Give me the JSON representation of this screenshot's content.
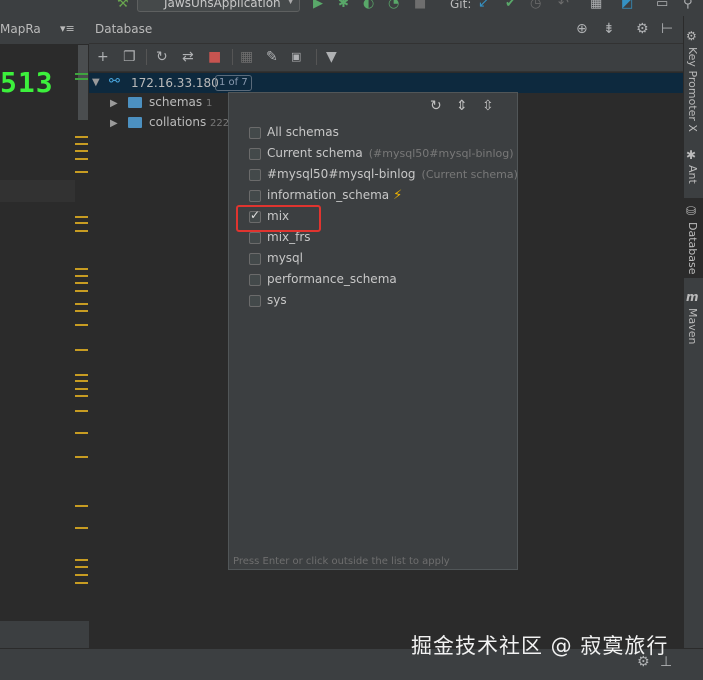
{
  "toolbar": {
    "run_config": "JawsUnsApplication",
    "git_label": "Git:"
  },
  "editor": {
    "tab_label": "MapRa",
    "tab_menu": "▾≡",
    "number_text": "513"
  },
  "database": {
    "title": "Database",
    "root": {
      "label": "172.16.33.180",
      "badge": "1 of 7"
    },
    "children": [
      {
        "label": "schemas",
        "count": "1"
      },
      {
        "label": "collations",
        "count": "222"
      }
    ]
  },
  "schema_popup": {
    "options": [
      {
        "label": "All schemas",
        "hint": "",
        "checked": false
      },
      {
        "label": "Current schema",
        "hint": "(#mysql50#mysql-binlog)",
        "checked": false
      },
      {
        "label": "#mysql50#mysql-binlog",
        "hint": "(Current schema)",
        "checked": false
      },
      {
        "label": "information_schema",
        "hint": "",
        "checked": false,
        "icon": "lightning-icon"
      },
      {
        "label": "mix",
        "hint": "",
        "checked": true
      },
      {
        "label": "mix_frs",
        "hint": "",
        "checked": false
      },
      {
        "label": "mysql",
        "hint": "",
        "checked": false
      },
      {
        "label": "performance_schema",
        "hint": "",
        "checked": false
      },
      {
        "label": "sys",
        "hint": "",
        "checked": false
      }
    ],
    "footer_hint": "Press Enter or click outside the list to apply",
    "highlight_color": "#e0342f"
  },
  "right_sidebar": {
    "tabs": [
      {
        "label": "Key Promoter X",
        "icon": "key-promoter-icon"
      },
      {
        "label": "Ant",
        "icon": "ant-icon"
      },
      {
        "label": "Database",
        "icon": "database-icon",
        "active": true
      },
      {
        "label": "Maven",
        "icon": "maven-icon"
      }
    ]
  },
  "watermark": "掘金技术社区 @ 寂寞旅行",
  "colors": {
    "accent_selection": "#0d293e",
    "editor_number": "#3cf03c",
    "folder": "#4c90c0"
  }
}
